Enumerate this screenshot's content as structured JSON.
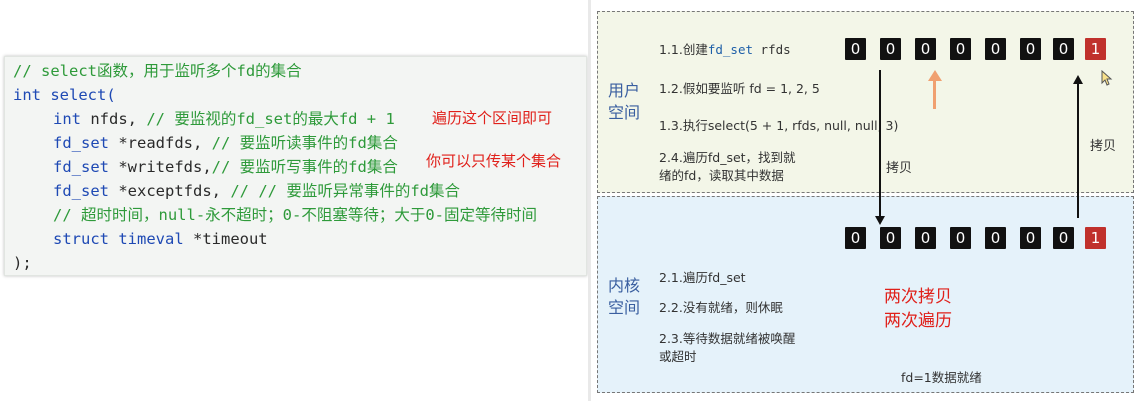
{
  "code": {
    "line1": "// select函数，用于监听多个fd的集合",
    "line2_kw": "int",
    "line2_rest": " select(",
    "line3_kw": "int",
    "line3_var": " nfds, ",
    "line3_comment": "// 要监视的fd_set的最大fd + 1",
    "line4_kw": "fd_set",
    "line4_var": " *readfds, ",
    "line4_comment": "// 要监听读事件的fd集合",
    "line5_kw": "fd_set",
    "line5_var": " *writefds,",
    "line5_comment": "// 要监听写事件的fd集合",
    "line6_kw": "fd_set",
    "line6_var": " *exceptfds, ",
    "line6_comment": "// // 要监听异常事件的fd集合",
    "line7_comment": "// 超时时间，null-永不超时；0-不阻塞等待；大于0-固定等待时间",
    "line8_kw": "struct",
    "line8_type": " timeval",
    "line8_var": " *timeout",
    "line9": ");"
  },
  "notes": {
    "traverse_range": "遍历这个区间即可",
    "pass_any": "你可以只传某个集合"
  },
  "user_space": {
    "label_1": "用户",
    "label_2": "空间",
    "step_1_1_prefix": "1.1.创建",
    "step_1_1_type": "fd_set",
    "step_1_1_var": " rfds",
    "step_1_2": "1.2.假如要监听 fd = 1, 2, 5",
    "step_1_3": "1.3.执行select(5 + 1, rfds, null, null, 3)",
    "step_2_4_line1": "2.4.遍历fd_set，找到就",
    "step_2_4_line2": "绪的fd，读取其中数据",
    "bits": [
      "0",
      "0",
      "0",
      "0",
      "0",
      "0",
      "0",
      "1"
    ],
    "copy_down_label": "拷贝",
    "copy_up_label": "拷贝"
  },
  "kernel_space": {
    "label_1": "内核",
    "label_2": "空间",
    "step_2_1": "2.1.遍历fd_set",
    "step_2_2": "2.2.没有就绪，则休眠",
    "step_2_3_line1": "2.3.等待数据就绪被唤醒",
    "step_2_3_line2": "或超时",
    "bits": [
      "0",
      "0",
      "0",
      "0",
      "0",
      "0",
      "0",
      "1"
    ],
    "ready_note": "fd=1数据就绪",
    "summary_line1": "两次拷贝",
    "summary_line2": "两次遍历"
  },
  "colors": {
    "comment": "#2e9a3a",
    "keyword": "#1e49b4",
    "annotation_red": "#e0201a",
    "bit_set": "#c0312c",
    "user_zone_bg": "#f3f6e8",
    "kernel_zone_bg": "#e5f2fa",
    "hint_arrow": "#f0a070"
  }
}
